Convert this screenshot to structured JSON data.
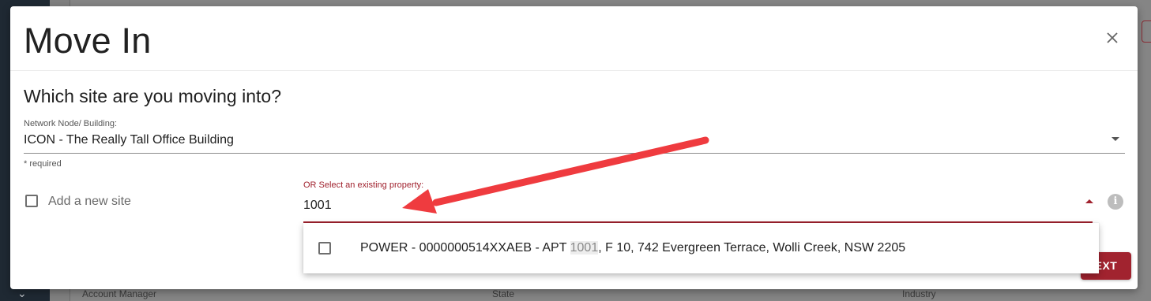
{
  "background": {
    "columns": [
      "Account Manager",
      "State",
      "Industry"
    ]
  },
  "modal": {
    "title": "Move In",
    "question": "Which site are you moving into?",
    "network_node": {
      "label": "Network Node/ Building:",
      "value": "ICON - The Really Tall Office Building",
      "helper": "* required"
    },
    "add_site": {
      "label": "Add a new site",
      "checked": false
    },
    "existing_property": {
      "label": "OR Select an existing property:",
      "value": "1001"
    },
    "info_icon": "info-icon",
    "next_button": "EXT",
    "dropdown": {
      "options": [
        {
          "prefix": "POWER - 0000000514XXAEB - APT ",
          "match": "1001",
          "suffix": ", F 10, 742 Evergreen Terrace, Wolli Creek, NSW 2205",
          "checked": false
        }
      ]
    }
  },
  "colors": {
    "accent": "#a1232f",
    "annotation_arrow": "#ef3b3f"
  }
}
